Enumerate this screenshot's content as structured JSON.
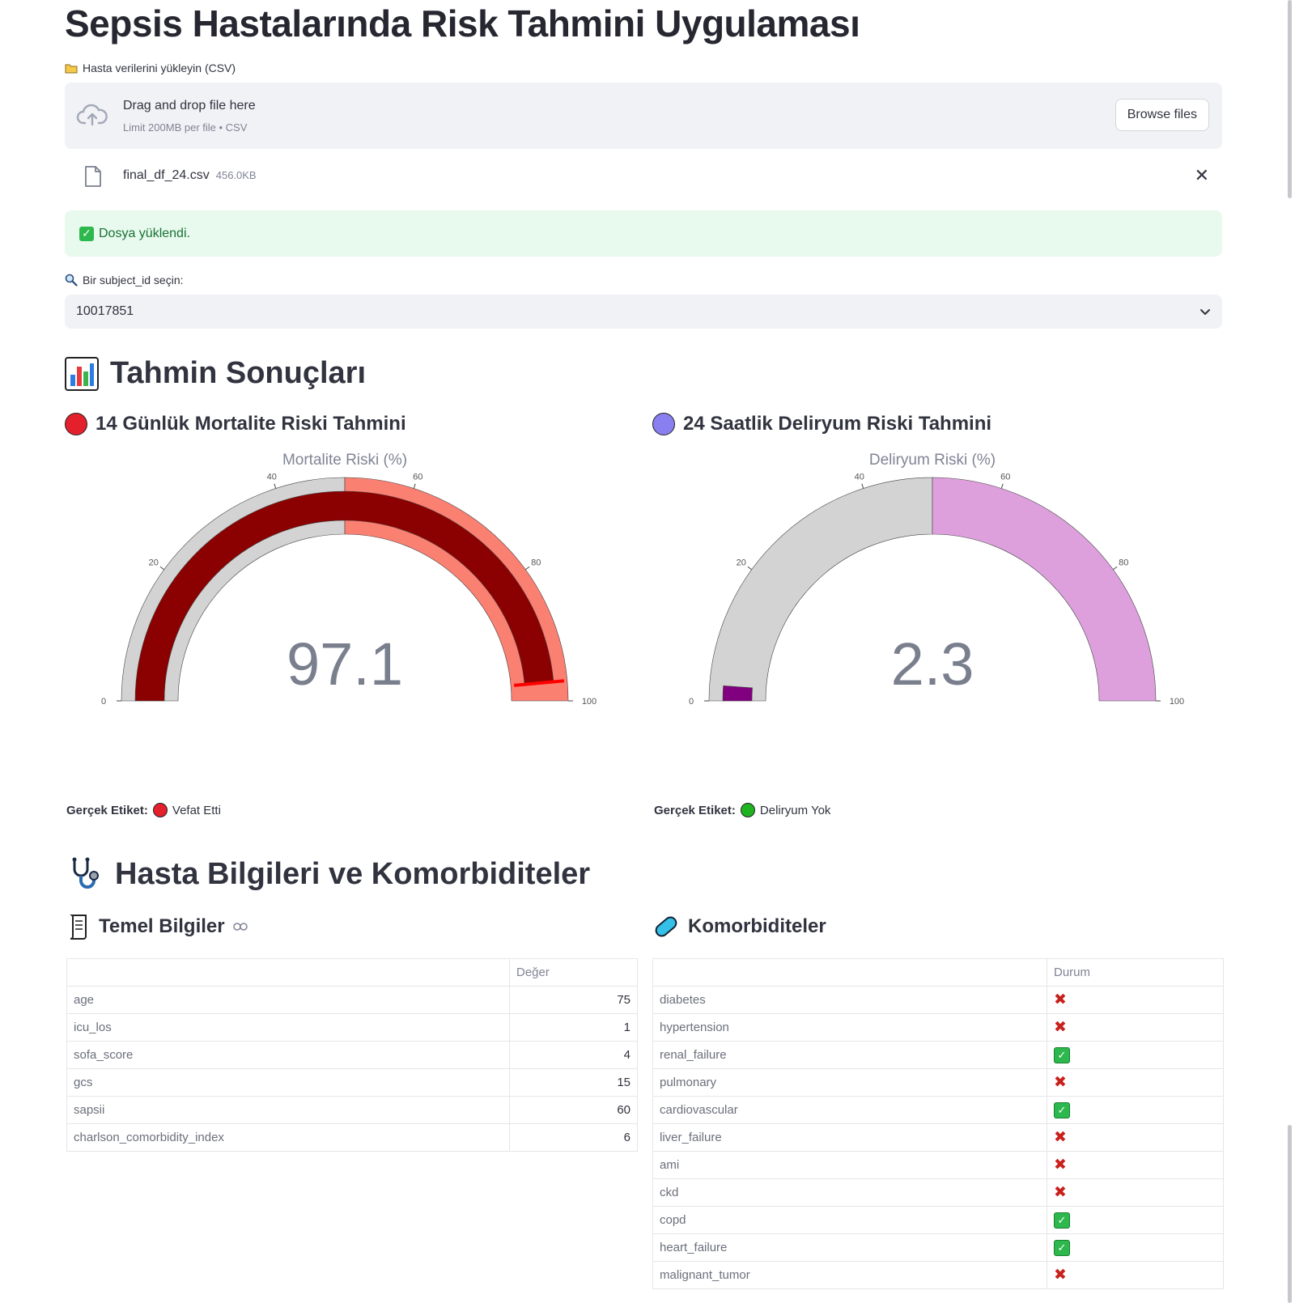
{
  "app": {
    "title": "Sepsis Hastalarında Risk Tahmini Uygulaması"
  },
  "upload": {
    "label": "Hasta verilerini yükleyin (CSV)",
    "drag_text": "Drag and drop file here",
    "limit_text": "Limit 200MB per file • CSV",
    "browse_label": "Browse files",
    "file_name": "final_df_24.csv",
    "file_size": "456.0KB",
    "success_text": "Dosya yüklendi."
  },
  "select": {
    "label": "Bir subject_id seçin:",
    "value": "10017851"
  },
  "results": {
    "heading": "Tahmin Sonuçları",
    "mortality": {
      "heading": "14 Günlük Mortalite Riski Tahmini",
      "gauge_title": "Mortalite Riski (%)",
      "value": 97.1,
      "value_text": "97.1",
      "ticks": [
        "0",
        "20",
        "40",
        "60",
        "80",
        "100"
      ],
      "label_prefix": "Gerçek Etiket:",
      "label_value": "Vefat Etti",
      "colors": {
        "bar": "#8b0000",
        "low": "#d3d3d3",
        "high": "#fa8072",
        "threshold": "#ff0000",
        "dot": "#e3202b",
        "label_dot": "#e3202b"
      }
    },
    "delirium": {
      "heading": "24 Saatlik Deliryum Riski Tahmini",
      "gauge_title": "Deliryum Riski (%)",
      "value": 2.3,
      "value_text": "2.3",
      "ticks": [
        "0",
        "20",
        "40",
        "60",
        "80",
        "100"
      ],
      "label_prefix": "Gerçek Etiket:",
      "label_value": "Deliryum Yok",
      "colors": {
        "bar": "#800080",
        "low": "#d3d3d3",
        "high": "#dda0dd",
        "dot": "#8a7ff0",
        "label_dot": "#1fb31f"
      }
    }
  },
  "patient": {
    "heading": "Hasta Bilgileri ve Komorbiditeler",
    "basic": {
      "heading": "Temel Bilgiler",
      "column": "Değer",
      "rows": [
        {
          "name": "age",
          "value": "75"
        },
        {
          "name": "icu_los",
          "value": "1"
        },
        {
          "name": "sofa_score",
          "value": "4"
        },
        {
          "name": "gcs",
          "value": "15"
        },
        {
          "name": "sapsii",
          "value": "60"
        },
        {
          "name": "charlson_comorbidity_index",
          "value": "6"
        }
      ]
    },
    "comorbidities": {
      "heading": "Komorbiditeler",
      "column": "Durum",
      "rows": [
        {
          "name": "diabetes",
          "present": false
        },
        {
          "name": "hypertension",
          "present": false
        },
        {
          "name": "renal_failure",
          "present": true
        },
        {
          "name": "pulmonary",
          "present": false
        },
        {
          "name": "cardiovascular",
          "present": true
        },
        {
          "name": "liver_failure",
          "present": false
        },
        {
          "name": "ami",
          "present": false
        },
        {
          "name": "ckd",
          "present": false
        },
        {
          "name": "copd",
          "present": true
        },
        {
          "name": "heart_failure",
          "present": true
        },
        {
          "name": "malignant_tumor",
          "present": false
        }
      ]
    }
  }
}
